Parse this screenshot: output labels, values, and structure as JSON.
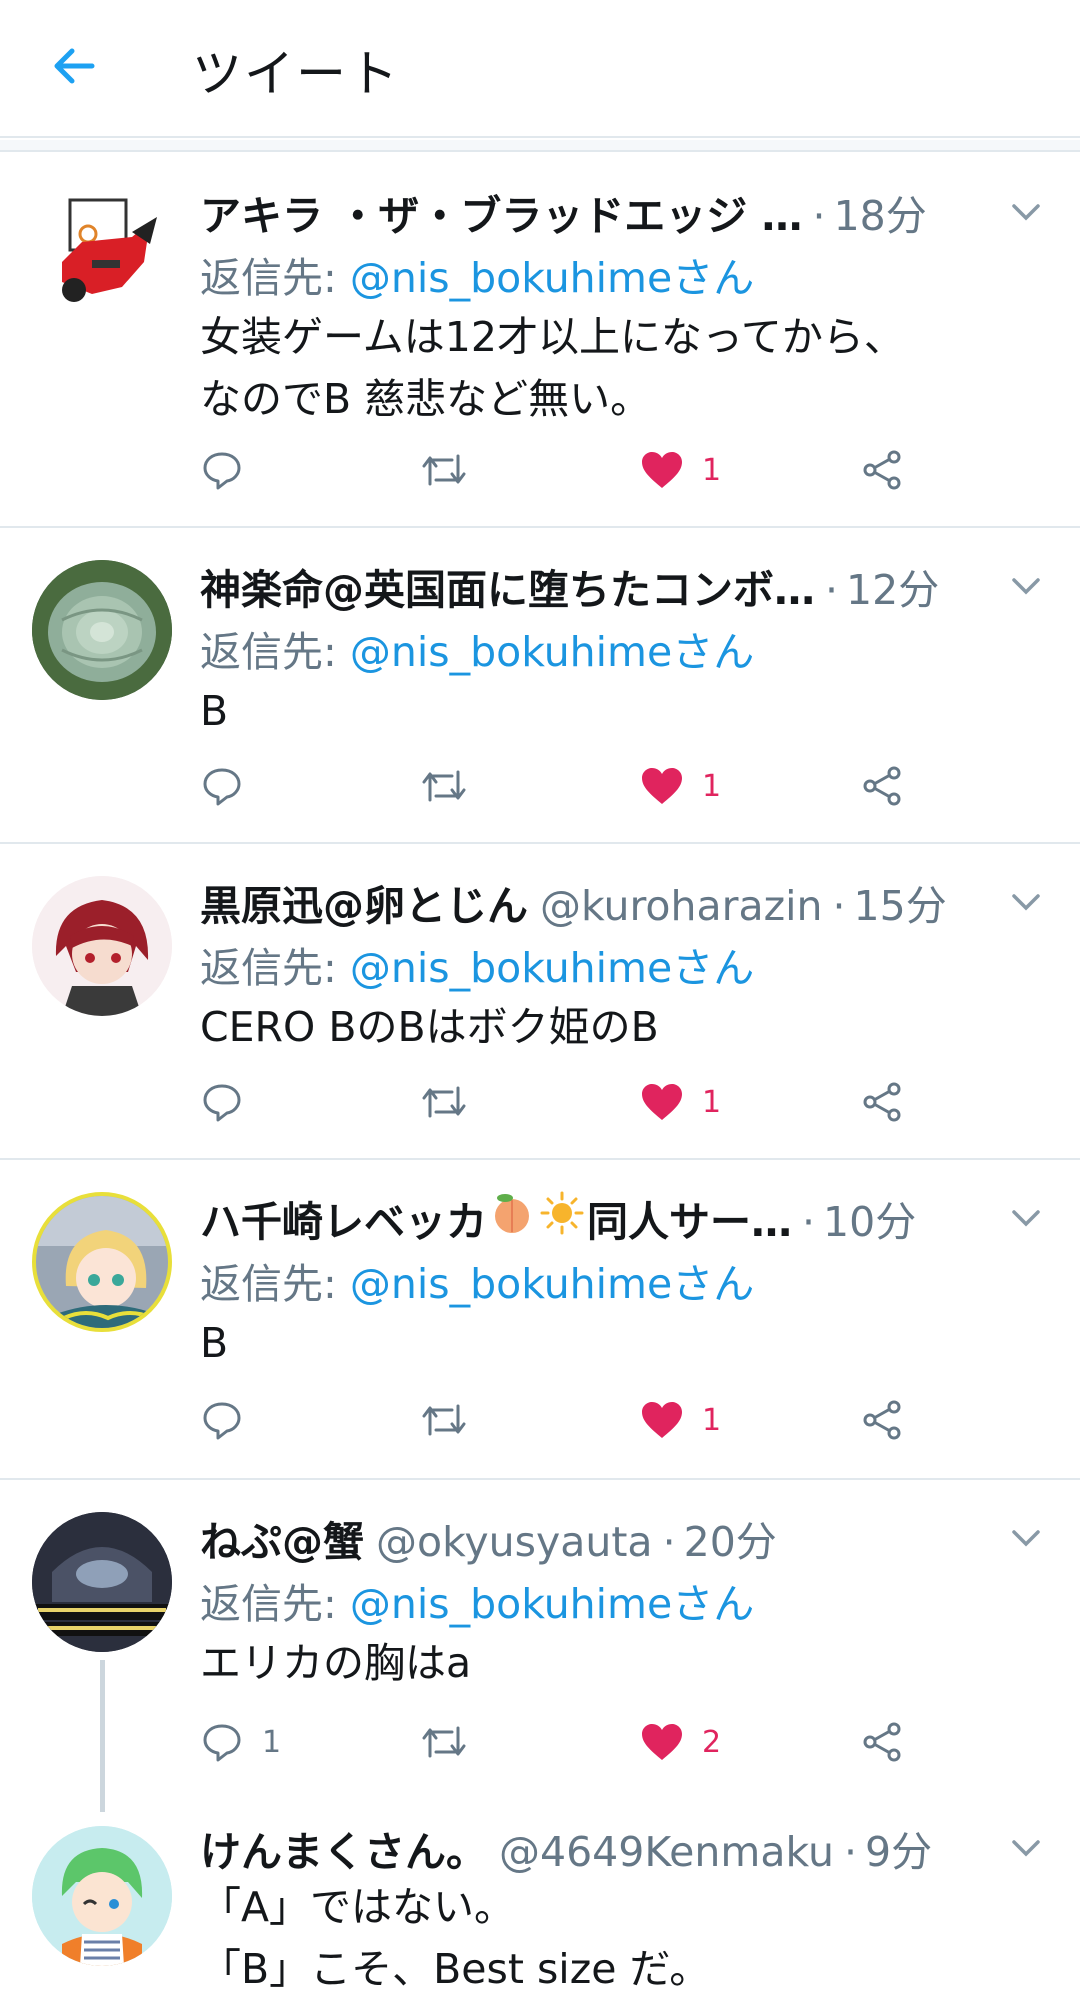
{
  "header": {
    "title": "ツイート"
  },
  "colors": {
    "accent": "#1b95e0",
    "like": "#e0245e",
    "muted": "#657786",
    "text": "#14171a",
    "divider": "#e1e8ed"
  },
  "tweets": [
    {
      "display_name": "アキラ ・ザ・ブラッドエッジ …",
      "handle": "",
      "time": "18分",
      "reply_prefix": "返信先: ",
      "reply_mention": "@nis_bokuhimeさん",
      "body": [
        "女装ゲームは12才以上になってから、",
        "なのでB 慈悲など無い。"
      ],
      "reply_count": "",
      "like_count": "1"
    },
    {
      "display_name": "神楽命@英国面に堕ちたコンボ…",
      "handle": "",
      "time": "12分",
      "reply_prefix": "返信先: ",
      "reply_mention": "@nis_bokuhimeさん",
      "body": [
        "B"
      ],
      "reply_count": "",
      "like_count": "1"
    },
    {
      "display_name": "黒原迅@卵とじん",
      "handle": "@kuroharazin",
      "time": "15分",
      "reply_prefix": "返信先: ",
      "reply_mention": "@nis_bokuhimeさん",
      "body": [
        "CERO BのBはボク姫のB"
      ],
      "reply_count": "",
      "like_count": "1"
    },
    {
      "display_name_a": "ハ千崎レベッカ",
      "display_name_b": "同人サー…",
      "handle": "",
      "time": "10分",
      "reply_prefix": "返信先: ",
      "reply_mention": "@nis_bokuhimeさん",
      "body": [
        "B"
      ],
      "reply_count": "",
      "like_count": "1",
      "emojis": [
        "peach-emoji",
        "sun-emoji"
      ]
    },
    {
      "display_name": "ねぷ@蟹",
      "handle": "@okyusyauta",
      "time": "20分",
      "reply_prefix": "返信先: ",
      "reply_mention": "@nis_bokuhimeさん",
      "body": [
        "エリカの胸はa"
      ],
      "reply_count": "1",
      "like_count": "2"
    },
    {
      "display_name": "けんまくさん。",
      "handle": "@4649Kenmaku",
      "time": "9分",
      "body": [
        "「A」ではない。",
        "「B」こそ、Best size だ。"
      ]
    }
  ]
}
